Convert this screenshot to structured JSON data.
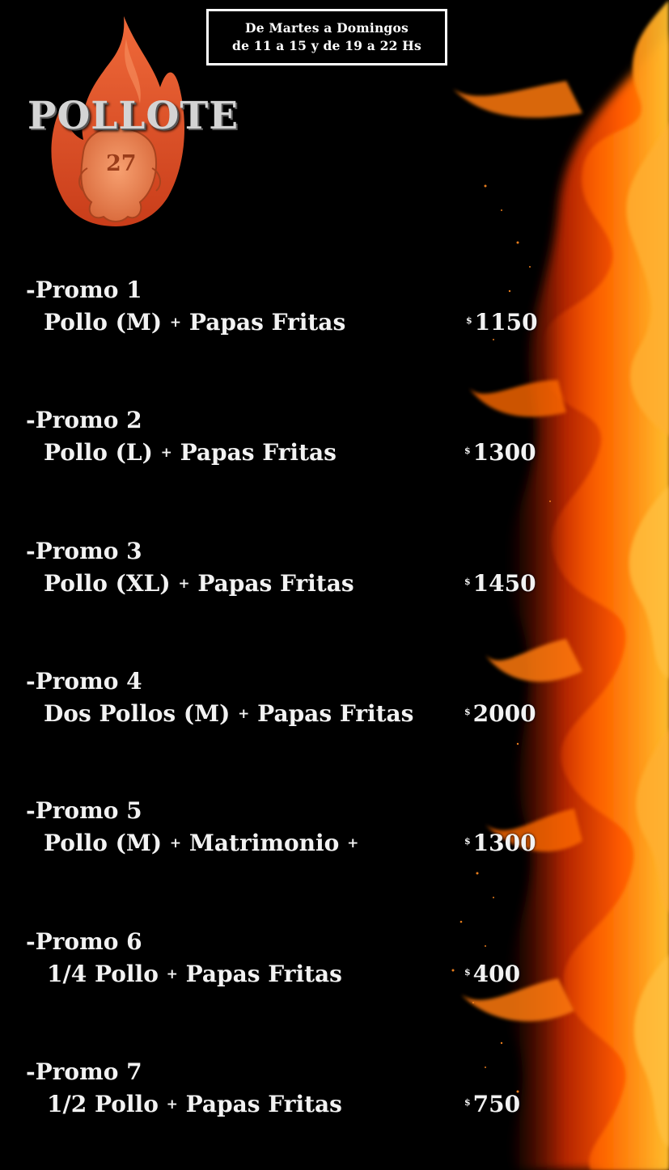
{
  "brand": {
    "name": "POLLOTE",
    "number": "27"
  },
  "hours": {
    "line1": "De Martes a Domingos",
    "line2": "de 11 a 15 y de 19 a 22 Hs"
  },
  "currency_symbol": "$",
  "plus_sign": "+",
  "promos": [
    {
      "title": "-Promo 1",
      "parts": [
        "Pollo (M)",
        "Papas  Fritas"
      ],
      "price": "1150"
    },
    {
      "title": "-Promo 2",
      "parts": [
        "Pollo (L)",
        "Papas  Fritas"
      ],
      "price": "1300"
    },
    {
      "title": "-Promo 3",
      "parts": [
        "Pollo (XL)",
        "Papas  Fritas"
      ],
      "price": "1450"
    },
    {
      "title": "-Promo 4",
      "parts": [
        "Dos Pollos (M)",
        "Papas Fritas"
      ],
      "price": "2000"
    },
    {
      "title": "-Promo 5",
      "parts": [
        "Pollo (M)",
        "Matrimonio",
        ""
      ],
      "price": "1300"
    },
    {
      "title": "-Promo 6",
      "parts": [
        "1/4 Pollo",
        "Papas  Fritas"
      ],
      "price": "400"
    },
    {
      "title": "-Promo 7",
      "parts": [
        "1/2 Pollo",
        "Papas  Fritas"
      ],
      "price": "750"
    }
  ],
  "colors": {
    "background": "#000000",
    "flame_orange": "#ff6a00",
    "flame_yellow": "#ffb200",
    "logo_flame": "#e8552a",
    "text": "#f2f2f2"
  }
}
